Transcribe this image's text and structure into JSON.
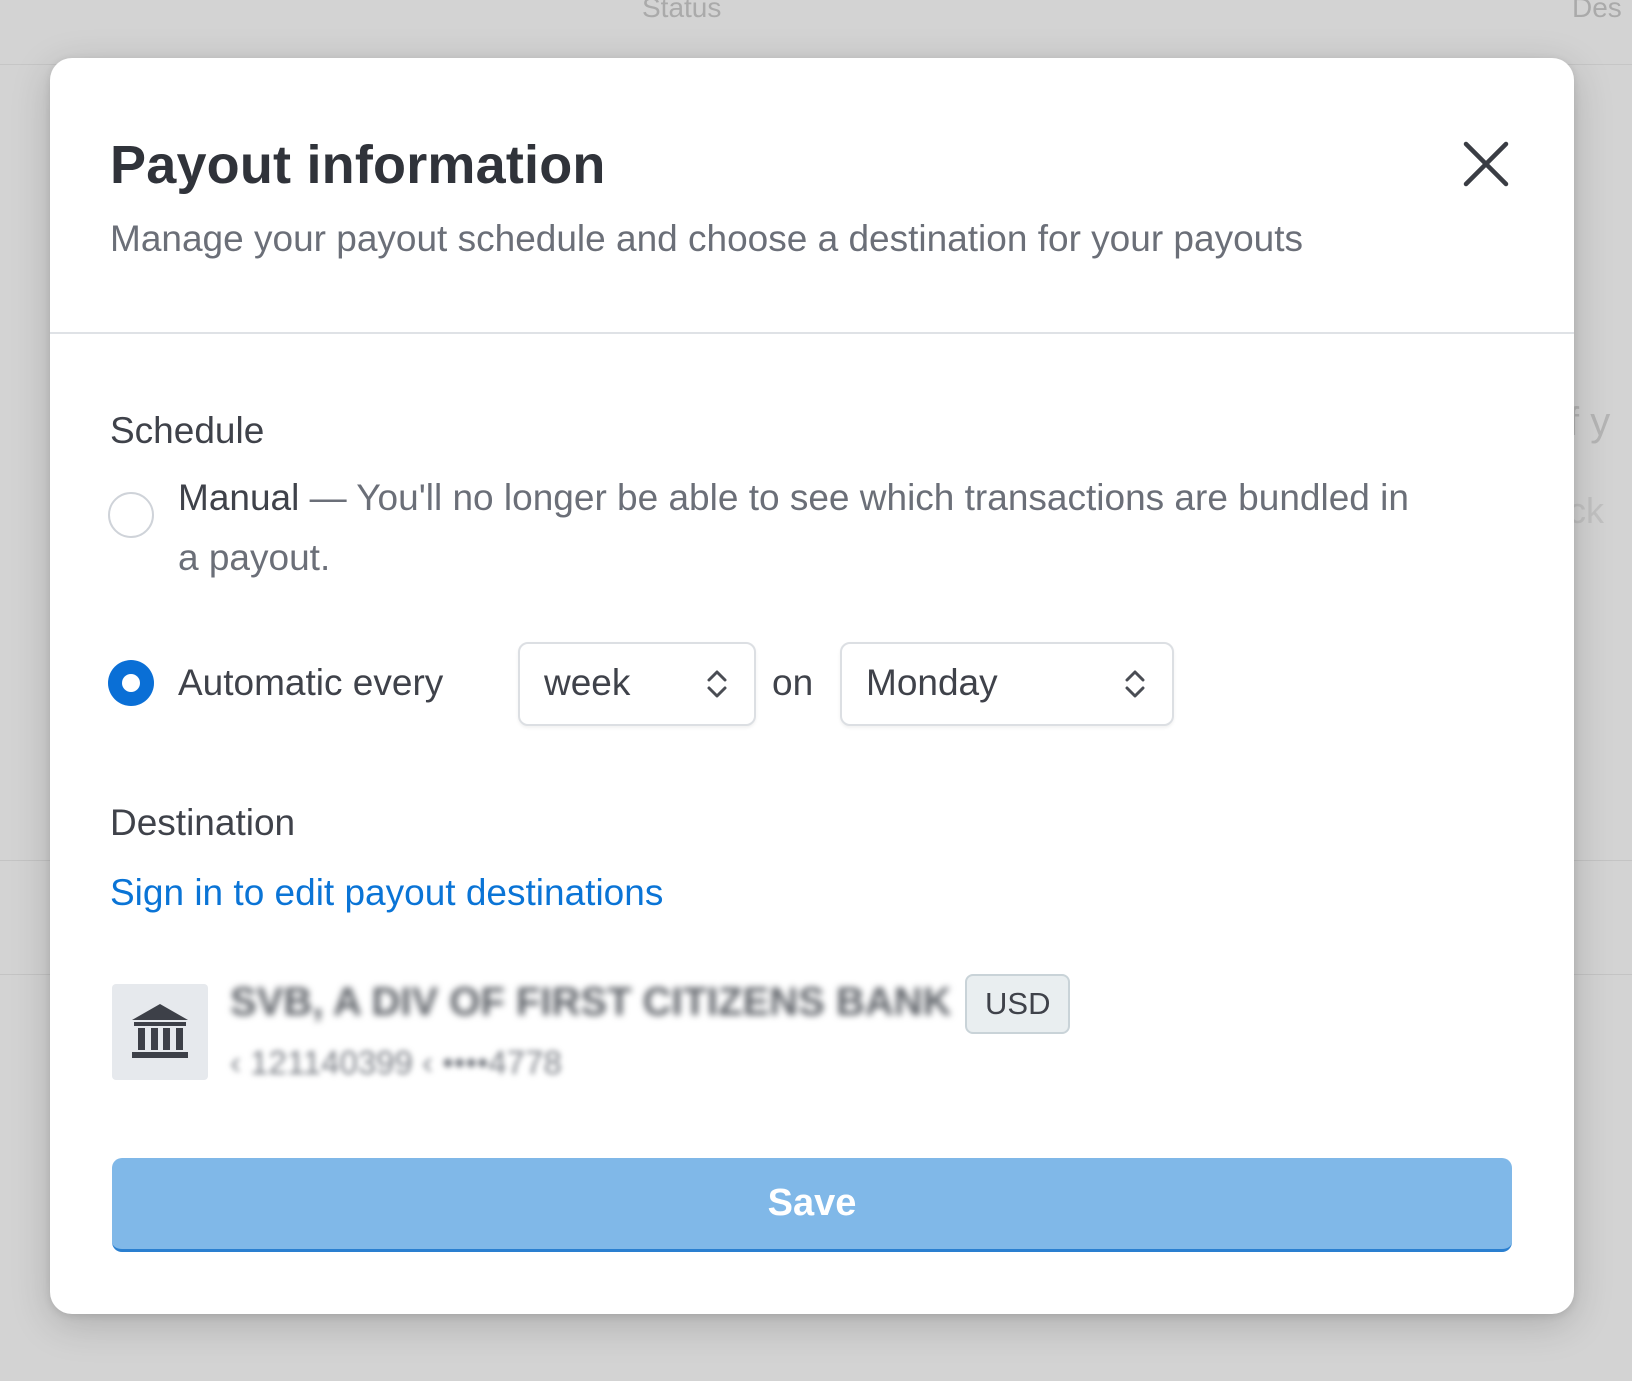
{
  "background": {
    "columns": [
      "Status",
      "Des"
    ],
    "side_fragments": [
      "f y",
      "ck"
    ]
  },
  "dialog": {
    "title": "Payout information",
    "subtitle": "Manage your payout schedule and choose a destination for your payouts",
    "close_icon": "close-icon"
  },
  "schedule": {
    "label": "Schedule",
    "manual": {
      "name": "Manual",
      "description": " — You'll no longer be able to see which transactions are bundled in a payout.",
      "selected": false
    },
    "automatic": {
      "label": "Automatic every",
      "selected": true,
      "interval_value": "week",
      "on_label": "on",
      "day_value": "Monday"
    }
  },
  "destination": {
    "label": "Destination",
    "signin_link": "Sign in to edit payout destinations",
    "bank": {
      "icon": "bank-icon",
      "name": "SVB, A DIV OF FIRST CITIZENS BANK",
      "currency": "USD",
      "details": "‹ 121140399 ‹ ••••4778"
    }
  },
  "actions": {
    "save_label": "Save"
  },
  "colors": {
    "accent": "#0a6fd6",
    "link": "#0a74d6",
    "save_disabled": "#80b8e8",
    "overlay": "#d3d3d3"
  }
}
